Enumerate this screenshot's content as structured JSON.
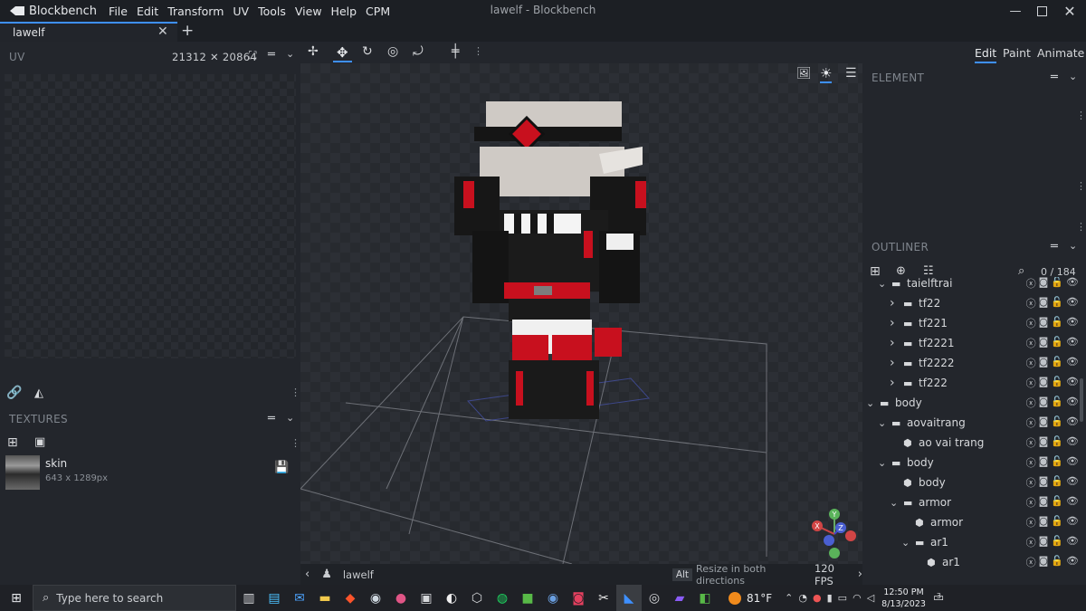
{
  "app": {
    "name": "Blockbench",
    "window_title": "lawelf - Blockbench"
  },
  "menu": [
    "File",
    "Edit",
    "Transform",
    "UV",
    "Tools",
    "View",
    "Help",
    "CPM"
  ],
  "tab": {
    "label": "lawelf"
  },
  "uv_panel": {
    "title": "UV",
    "size": "21312 ✕ 20864"
  },
  "textures_panel": {
    "title": "TEXTURES",
    "texture_name": "skin",
    "texture_size": "643 x 1289px"
  },
  "modes": [
    "Edit",
    "Paint",
    "Animate"
  ],
  "element_panel": {
    "title": "ELEMENT"
  },
  "outliner": {
    "title": "OUTLINER",
    "count": "0 / 184",
    "rows": [
      {
        "label": "taielftrai",
        "type": "folder",
        "depth": 1,
        "open": true
      },
      {
        "label": "tf22",
        "type": "folder",
        "depth": 2,
        "open": false
      },
      {
        "label": "tf221",
        "type": "folder",
        "depth": 2,
        "open": false
      },
      {
        "label": "tf2221",
        "type": "folder",
        "depth": 2,
        "open": false
      },
      {
        "label": "tf2222",
        "type": "folder",
        "depth": 2,
        "open": false
      },
      {
        "label": "tf222",
        "type": "folder",
        "depth": 2,
        "open": false
      },
      {
        "label": "body",
        "type": "folder",
        "depth": 0,
        "open": true
      },
      {
        "label": "aovaitrang",
        "type": "folder",
        "depth": 1,
        "open": true
      },
      {
        "label": "ao vai trang",
        "type": "cube",
        "depth": 2
      },
      {
        "label": "body",
        "type": "folder",
        "depth": 1,
        "open": true
      },
      {
        "label": "body",
        "type": "cube",
        "depth": 2
      },
      {
        "label": "armor",
        "type": "folder",
        "depth": 2,
        "open": true
      },
      {
        "label": "armor",
        "type": "cube",
        "depth": 3
      },
      {
        "label": "ar1",
        "type": "folder",
        "depth": 3,
        "open": true
      },
      {
        "label": "ar1",
        "type": "cube",
        "depth": 4
      }
    ]
  },
  "status": {
    "model_name": "lawelf",
    "key_hint": "Alt",
    "hint_text": "Resize in both directions",
    "fps": "120 FPS"
  },
  "taskbar": {
    "search_placeholder": "Type here to search",
    "weather": "81°F",
    "time": "12:50 PM",
    "date": "8/13/2023",
    "notifications": "3"
  },
  "colors": {
    "accent": "#3e90ff",
    "panel": "#23262c",
    "viewport": "#2c2f35",
    "model_red": "#c8101e"
  }
}
